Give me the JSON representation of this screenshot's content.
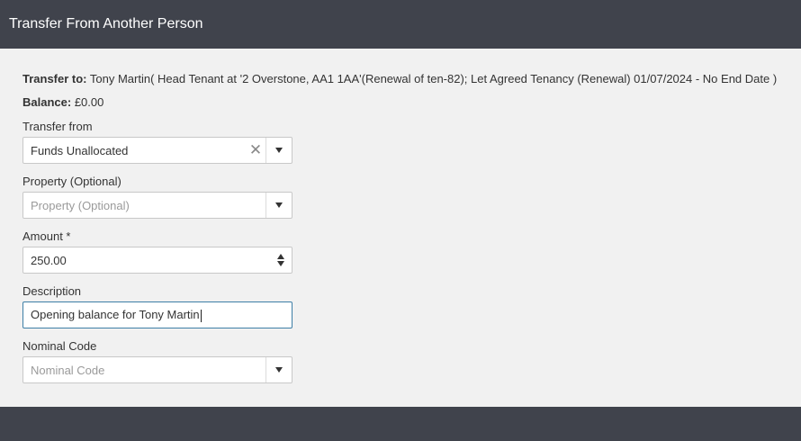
{
  "header": {
    "title": "Transfer From Another Person"
  },
  "info": {
    "transfer_to_label": "Transfer to:",
    "transfer_to_value": "Tony Martin( Head Tenant at '2 Overstone, AA1 1AA'(Renewal of ten-82); Let Agreed Tenancy (Renewal) 01/07/2024 - No End Date )",
    "balance_label": "Balance:",
    "balance_value": "£0.00"
  },
  "form": {
    "transfer_from": {
      "label": "Transfer from",
      "value": "Funds Unallocated",
      "clear_glyph": "✕"
    },
    "property": {
      "label": "Property (Optional)",
      "placeholder": "Property (Optional)"
    },
    "amount": {
      "label": "Amount *",
      "value": "250.00"
    },
    "description": {
      "label": "Description",
      "value": "Opening balance for Tony Martin"
    },
    "nominal_code": {
      "label": "Nominal Code",
      "placeholder": "Nominal Code"
    }
  },
  "colors": {
    "header_bg": "#40434c",
    "body_bg": "#f1f1f1",
    "focus_border": "#3d7ea6"
  }
}
